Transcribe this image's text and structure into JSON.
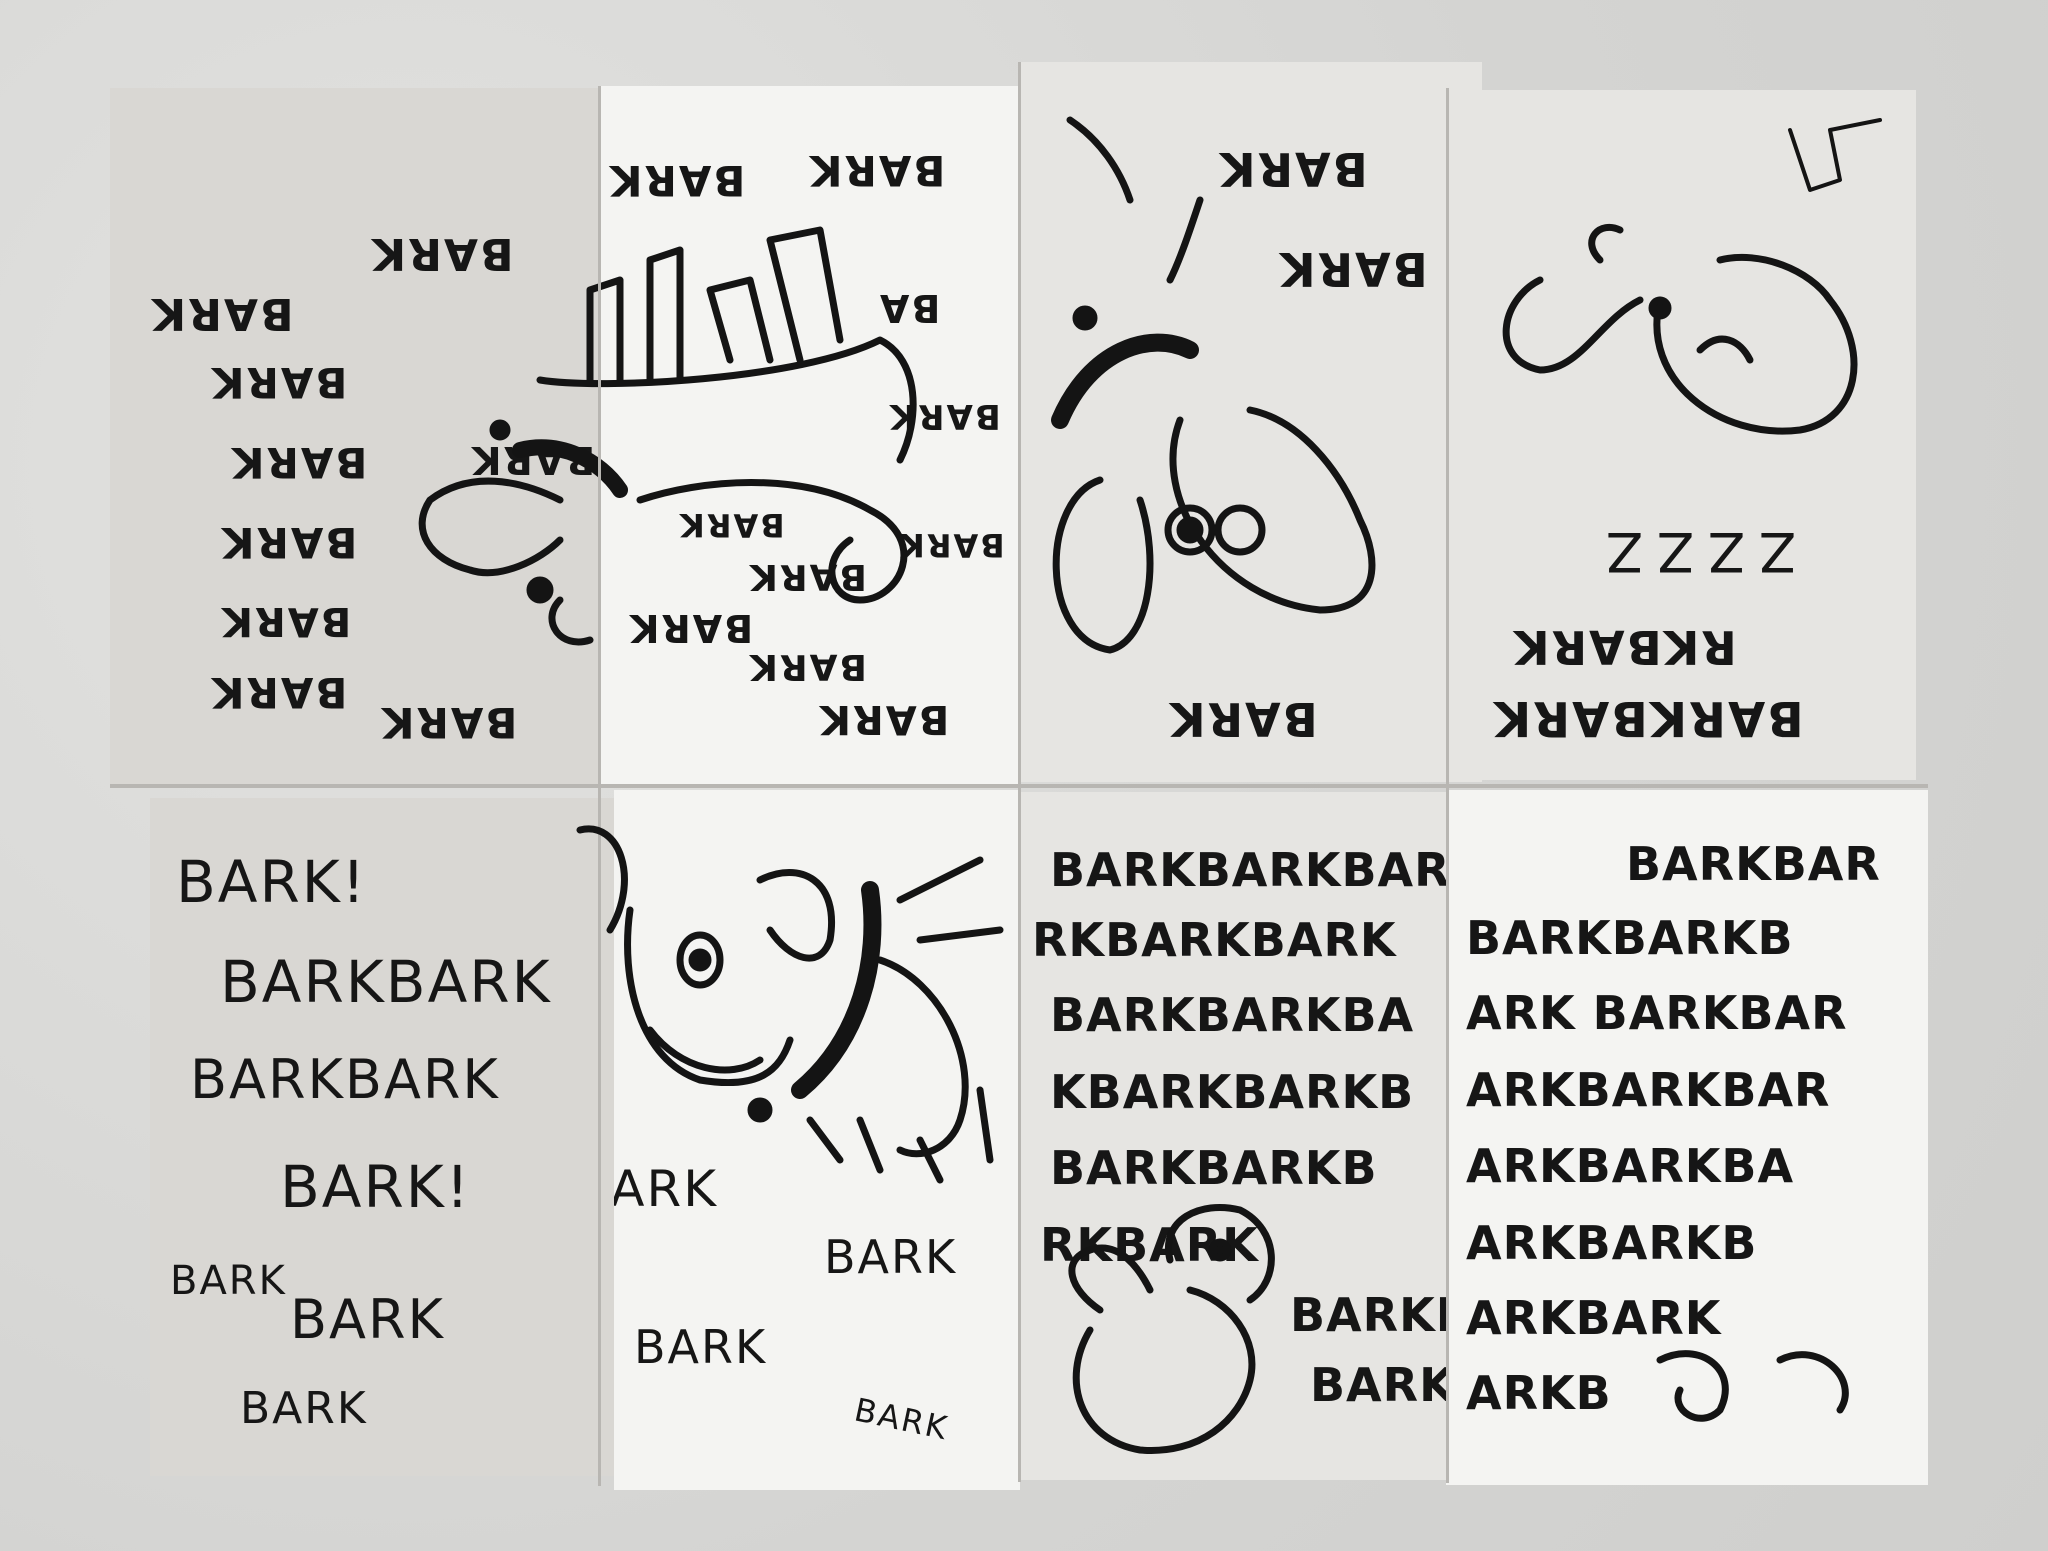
{
  "colors": {
    "paper_white": "#f4f4f2",
    "paper_grey": "#d9d7d3",
    "ink": "#141414",
    "background": "#d8d8d6"
  },
  "top_row": {
    "panel_1": {
      "words": [
        "BARK",
        "BARK",
        "BARK",
        "BARK",
        "BARK",
        "BARK",
        "BARK",
        "BARK",
        "BARK"
      ]
    },
    "panel_2": {
      "words": [
        "BARK",
        "BARK",
        "BA",
        "BARK",
        "BARK",
        "BARK",
        "BARK",
        "BARK",
        "BARK",
        "BARK"
      ]
    },
    "panel_3": {
      "words": [
        "BARK",
        "BARK",
        "BARK"
      ]
    },
    "panel_4": {
      "snore": "ZZZZ",
      "words": [
        "RKBARK",
        "BARKBARK"
      ]
    }
  },
  "bottom_row": {
    "panel_5": {
      "lines": [
        "BARK!",
        "BARKBARK",
        "BARKBARK",
        "BARK!",
        "BARK",
        "BARK",
        "BARK"
      ]
    },
    "panel_6": {
      "lines": [
        "BARK",
        "BARK",
        "BARK",
        "BARK"
      ]
    },
    "panel_7": {
      "lines": [
        "BARKBARKBARK",
        "RKBARKBARK",
        "BARKBARKBA",
        "KBARKBARKB",
        "BARKBARKB",
        "RKBARK",
        "BARKBARK",
        "BARKBARK"
      ]
    },
    "panel_8": {
      "lines": [
        "BARKBAR",
        "BARKBARKB",
        "ARK BARKBAR",
        "ARKBARKBAR",
        "ARKBARKBA",
        "ARKBARKB",
        "ARKBARK",
        "ARKB"
      ]
    }
  }
}
